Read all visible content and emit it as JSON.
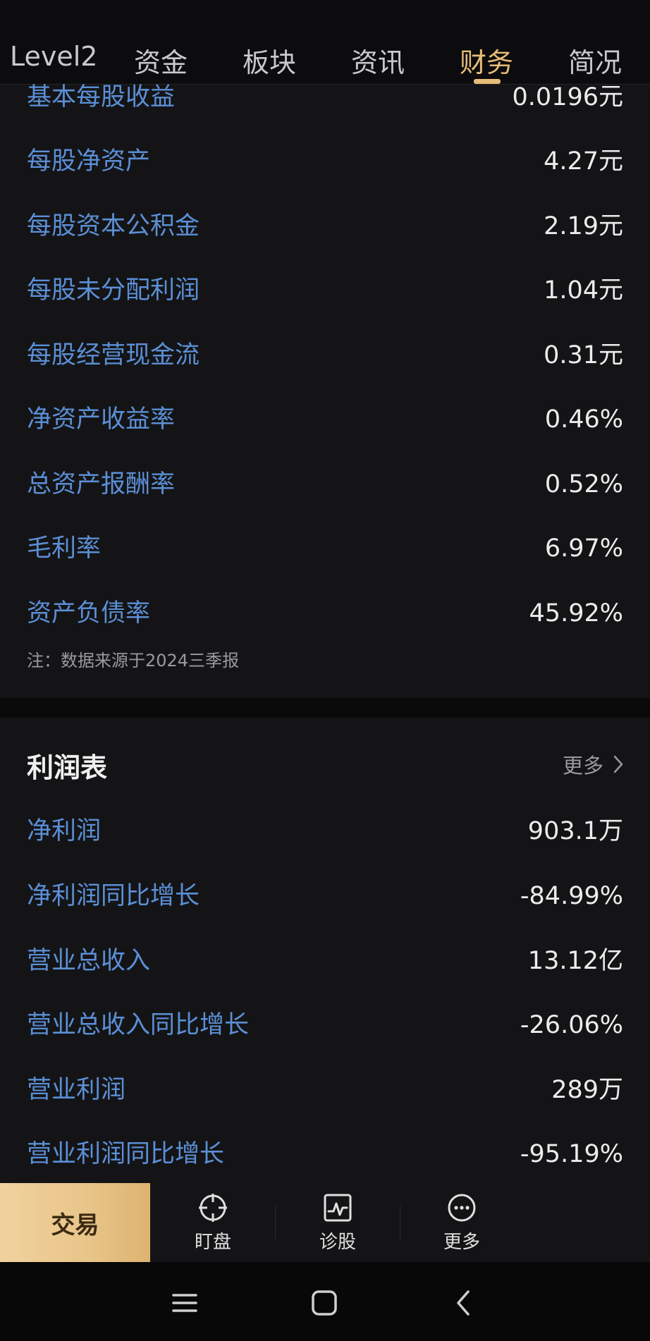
{
  "tabs": [
    {
      "label": "Level2"
    },
    {
      "label": "资金"
    },
    {
      "label": "板块"
    },
    {
      "label": "资讯"
    },
    {
      "label": "财务",
      "active": true
    },
    {
      "label": "简况"
    }
  ],
  "finance_indicators": [
    {
      "label": "基本每股收益",
      "value": "0.0196元"
    },
    {
      "label": "每股净资产",
      "value": "4.27元"
    },
    {
      "label": "每股资本公积金",
      "value": "2.19元"
    },
    {
      "label": "每股未分配利润",
      "value": "1.04元"
    },
    {
      "label": "每股经营现金流",
      "value": "0.31元"
    },
    {
      "label": "净资产收益率",
      "value": "0.46%"
    },
    {
      "label": "总资产报酬率",
      "value": "0.52%"
    },
    {
      "label": "毛利率",
      "value": "6.97%"
    },
    {
      "label": "资产负债率",
      "value": "45.92%"
    }
  ],
  "note": "注：数据来源于2024三季报",
  "income_statement": {
    "title": "利润表",
    "more_label": "更多",
    "rows": [
      {
        "label": "净利润",
        "value": "903.1万"
      },
      {
        "label": "净利润同比增长",
        "value": "-84.99%"
      },
      {
        "label": "营业总收入",
        "value": "13.12亿"
      },
      {
        "label": "营业总收入同比增长",
        "value": "-26.06%"
      },
      {
        "label": "营业利润",
        "value": "289万"
      },
      {
        "label": "营业利润同比增长",
        "value": "-95.19%"
      }
    ]
  },
  "actionbar": {
    "trade_label": "交易",
    "watch_label": "盯盘",
    "diagnose_label": "诊股",
    "more_label": "更多"
  },
  "colors": {
    "accent": "#e7bd78",
    "label_blue": "#5b8fd6",
    "background": "#141416"
  }
}
